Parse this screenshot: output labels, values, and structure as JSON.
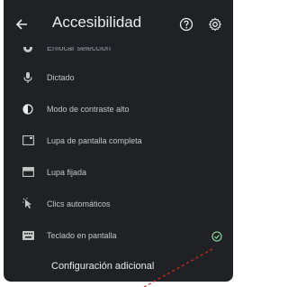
{
  "header": {
    "title": "Accesibilidad"
  },
  "icons": {
    "back": "arrow-back-icon",
    "help": "help-icon",
    "settings": "gear-icon"
  },
  "colors": {
    "panel_bg": "#202124",
    "text_primary": "#e8eaed",
    "text_secondary": "#c4c7c5",
    "accent_check": "#81c995",
    "pointer": "#d93025"
  },
  "list": {
    "items": [
      {
        "label": "Enfocar selección",
        "icon": "select-focus-icon"
      },
      {
        "label": "Dictado",
        "icon": "microphone-icon"
      },
      {
        "label": "Modo de contraste alto",
        "icon": "contrast-icon"
      },
      {
        "label": "Lupa de pantalla completa",
        "icon": "fullscreen-magnifier-icon"
      },
      {
        "label": "Lupa fijada",
        "icon": "docked-magnifier-icon"
      },
      {
        "label": "Clics automáticos",
        "icon": "auto-click-icon"
      },
      {
        "label": "Teclado en pantalla",
        "icon": "keyboard-icon",
        "enabled": true
      }
    ]
  },
  "more": {
    "label": "Configuración adicional"
  }
}
